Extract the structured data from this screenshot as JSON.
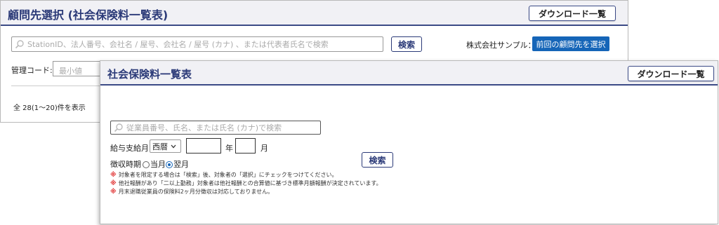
{
  "back_window": {
    "title": "顧問先選択 (社会保険料一覧表)",
    "download_label": "ダウンロード一覧",
    "search_placeholder": "StationID、法人番号、会社名 / 屋号、会社名 / 屋号 (カナ) 、または代表者氏名で検索",
    "search_button": "検索",
    "company_label": "株式会社サンプル：",
    "previous_client_button": "前回の顧問先を選択",
    "management_code_label": "管理コード:",
    "management_code_placeholder": "最小値",
    "count_text": "全 28(1〜20)件を表示"
  },
  "front_window": {
    "title": "社会保険料一覧表",
    "download_label": "ダウンロード一覧",
    "search_placeholder": "従業員番号、氏名、または氏名 (カナ)で検索",
    "pay_month_label": "給与支給月",
    "era_select_value": "西暦",
    "year_value": "",
    "year_unit": "年",
    "month_value": "",
    "month_unit": "月",
    "collection_label": "徴収時期",
    "option_current": "当月",
    "option_next": "翌月",
    "selected_option": "翌月",
    "search_button": "検索",
    "notes": [
      "対象者を限定する場合は「検索」後、対象者の「選択」にチェックをつけてください。",
      "他社報酬があり「二以上勤務」対象者は他社報酬との合算値に基づき標準月額報酬が決定されています。",
      "月末退職従業員の保険料2ヶ月分徴収は対応しておりません。"
    ],
    "note_mark": "※"
  },
  "colors": {
    "accent_navy": "#2b3a78",
    "primary_blue": "#1565b8",
    "note_mark_red": "#e03030"
  }
}
